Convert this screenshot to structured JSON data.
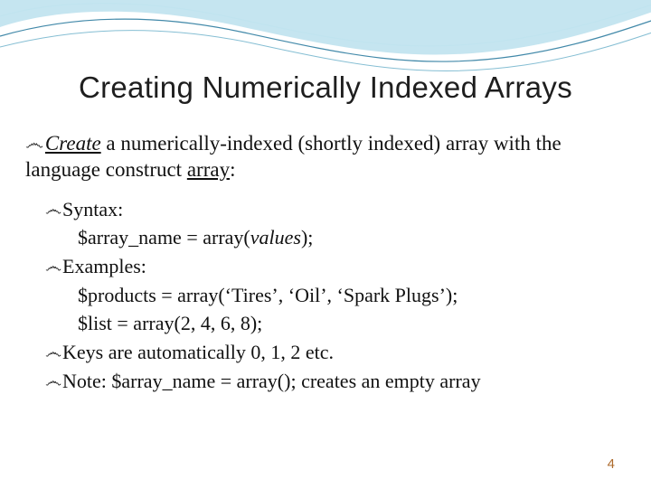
{
  "title": "Creating Numerically Indexed Arrays",
  "lead": {
    "create_word": "Create",
    "rest_before_array": " a numerically-indexed (shortly indexed) array with the language construct ",
    "array_word": "array",
    "colon": ":"
  },
  "bul": {
    "syntax_label": "Syntax:",
    "syntax_line_prefix": "$array_name = array(",
    "syntax_line_values": "values",
    "syntax_line_suffix": ");",
    "examples_label": "Examples:",
    "ex1": "$products = array(‘Tires’, ‘Oil’, ‘Spark Plugs’);",
    "ex2": "$list = array(2, 4, 6, 8);",
    "keys": "Keys are automatically 0, 1, 2 etc.",
    "note": "Note: $array_name = array(); creates an empty array"
  },
  "page_number": "4",
  "swash_glyph": "෴"
}
